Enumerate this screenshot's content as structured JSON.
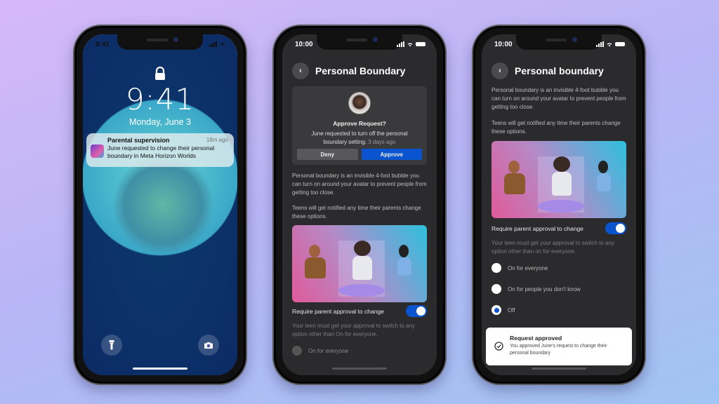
{
  "phone_lock": {
    "status_time": "9:41",
    "lock_icon": "lock-icon",
    "time": "9:41",
    "date": "Monday, June 3",
    "notification": {
      "app_icon": "meta-horizon-worlds-icon",
      "title": "Parental supervision",
      "time_ago": "18m ago",
      "body": "June requested to change their personal boundary in Meta Horizon Worlds"
    },
    "buttons": [
      {
        "icon": "flashlight-icon"
      },
      {
        "icon": "camera-icon"
      }
    ]
  },
  "phone_request": {
    "status_time": "10:00",
    "title": "Personal Boundary",
    "back_icon": "chevron-left-icon",
    "request_card": {
      "title": "Approve Request?",
      "body": "June requested to turn off the personal boundary setting.",
      "time_ago": "3 days ago",
      "deny_label": "Deny",
      "approve_label": "Approve"
    },
    "description": "Personal boundary is an invisible 4-foot bubble you can turn on around your avatar to prevent people from getting too close.",
    "notice": "Teens will get notified any time their parents change these options.",
    "toggle_label": "Require parent approval to change",
    "toggle_on": true,
    "hint": "Your teen must get your approval to switch to any option other than On for everyone.",
    "options": [
      {
        "label": "On for everyone",
        "checked": false
      }
    ]
  },
  "phone_approved": {
    "status_time": "10:00",
    "title": "Personal boundary",
    "back_icon": "chevron-left-icon",
    "description": "Personal boundary is an invisible 4-foot bubble you can turn on around your avatar to prevent people from getting too close.",
    "notice": "Teens will get notified any time their parents change these options.",
    "toggle_label": "Require parent approval to change",
    "toggle_on": true,
    "hint": "Your teen must get your approval to switch to any option other than on for everyone.",
    "options": [
      {
        "label": "On for everyone",
        "checked": false
      },
      {
        "label": "On for people you don't know",
        "checked": false
      },
      {
        "label": "Off",
        "checked": true
      }
    ],
    "toast": {
      "icon": "check-circle-icon",
      "title": "Request approved",
      "body": "You approved June's request to change their personal boundary"
    }
  },
  "colors": {
    "accent": "#0a55cf",
    "app_background": "#2b2b2d",
    "card": "#3a3a3c"
  }
}
